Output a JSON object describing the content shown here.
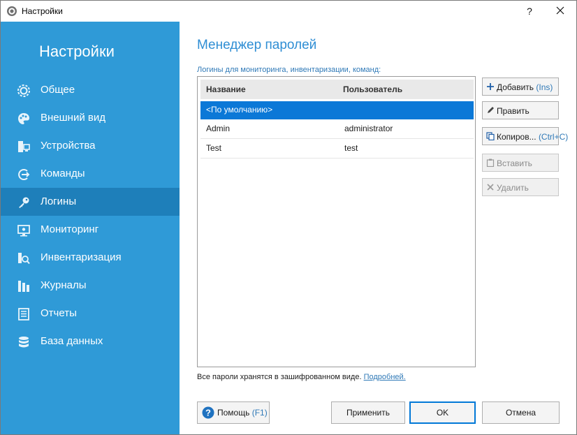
{
  "window": {
    "title": "Настройки",
    "help_glyph": "?"
  },
  "sidebar": {
    "title": "Настройки",
    "items": [
      {
        "label": "Общее",
        "icon": "gear-icon",
        "active": false
      },
      {
        "label": "Внешний вид",
        "icon": "palette-icon",
        "active": false
      },
      {
        "label": "Устройства",
        "icon": "devices-icon",
        "active": false
      },
      {
        "label": "Команды",
        "icon": "command-icon",
        "active": false
      },
      {
        "label": "Логины",
        "icon": "key-icon",
        "active": true
      },
      {
        "label": "Мониторинг",
        "icon": "monitor-icon",
        "active": false
      },
      {
        "label": "Инвентаризация",
        "icon": "inventory-search-icon",
        "active": false
      },
      {
        "label": "Журналы",
        "icon": "journal-icon",
        "active": false
      },
      {
        "label": "Отчеты",
        "icon": "report-icon",
        "active": false
      },
      {
        "label": "База данных",
        "icon": "database-icon",
        "active": false
      }
    ]
  },
  "main": {
    "title": "Менеджер паролей",
    "list_caption": "Логины для мониторинга, инвентаризации, команд:",
    "columns": [
      "Название",
      "Пользователь"
    ],
    "rows": [
      {
        "name": "<По умолчанию>",
        "user": "",
        "selected": true
      },
      {
        "name": "Admin",
        "user": "administrator",
        "selected": false
      },
      {
        "name": "Test",
        "user": "test",
        "selected": false
      }
    ],
    "buttons": {
      "add": {
        "label": "Добавить",
        "hint": "(Ins)",
        "icon": "plus-icon",
        "enabled": true
      },
      "edit": {
        "label": "Править",
        "hint": "",
        "icon": "pencil-icon",
        "enabled": true
      },
      "copy": {
        "label": "Копиров...",
        "hint": "(Ctrl+C)",
        "icon": "copy-icon",
        "enabled": true
      },
      "paste": {
        "label": "Вставить",
        "hint": "",
        "icon": "paste-icon",
        "enabled": false
      },
      "delete": {
        "label": "Удалить",
        "hint": "",
        "icon": "delete-x-icon",
        "enabled": false
      }
    },
    "footer_note": "Все пароли хранятся в зашифрованном виде.",
    "footer_link": "Подробней."
  },
  "bottom": {
    "help_label": "Помощь",
    "help_hint": "(F1)",
    "apply_label": "Применить",
    "ok_label": "OK",
    "cancel_label": "Отмена"
  },
  "colors": {
    "sidebar_bg": "#2f9ad7",
    "sidebar_active": "#1e7fba",
    "accent": "#2f8ed4",
    "selection": "#0b78d7"
  }
}
